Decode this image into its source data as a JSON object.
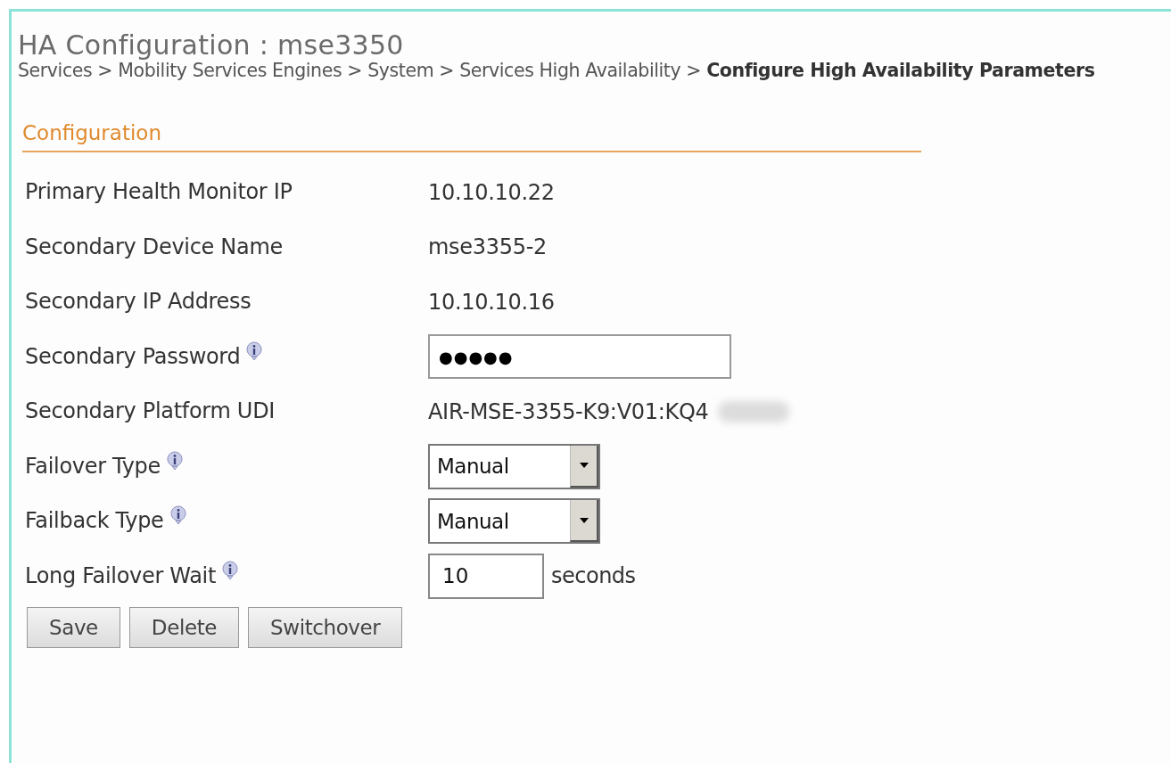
{
  "header": {
    "title": "HA Configuration : mse3350",
    "breadcrumb": "Services > Mobility Services Engines > System > Services High Availability > **Configure High Availability Parameters**"
  },
  "section": {
    "title": "Configuration"
  },
  "fields": [
    {
      "kind": "text",
      "label": "Primary Health Monitor IP",
      "info": false,
      "value": "10.10.10.22"
    },
    {
      "kind": "text",
      "label": "Secondary Device Name",
      "info": false,
      "value": "mse3355-2"
    },
    {
      "kind": "text",
      "label": "Secondary IP Address",
      "info": false,
      "value": "10.10.10.16"
    },
    {
      "kind": "password",
      "label": "Secondary Password",
      "info": true,
      "value": "●●●●●"
    },
    {
      "kind": "text",
      "label": "Secondary Platform UDI",
      "info": false,
      "value": "AIR-MSE-3355-K9:V01:KQ4",
      "redacted": true
    },
    {
      "kind": "select",
      "label": "Failover Type",
      "info": true,
      "value": "Manual"
    },
    {
      "kind": "select",
      "label": "Failback Type",
      "info": true,
      "value": "Manual"
    },
    {
      "kind": "number",
      "label": "Long Failover Wait",
      "info": true,
      "value": "10",
      "unit": "seconds"
    }
  ],
  "buttons": [
    "Save",
    "Delete",
    "Switchover"
  ]
}
